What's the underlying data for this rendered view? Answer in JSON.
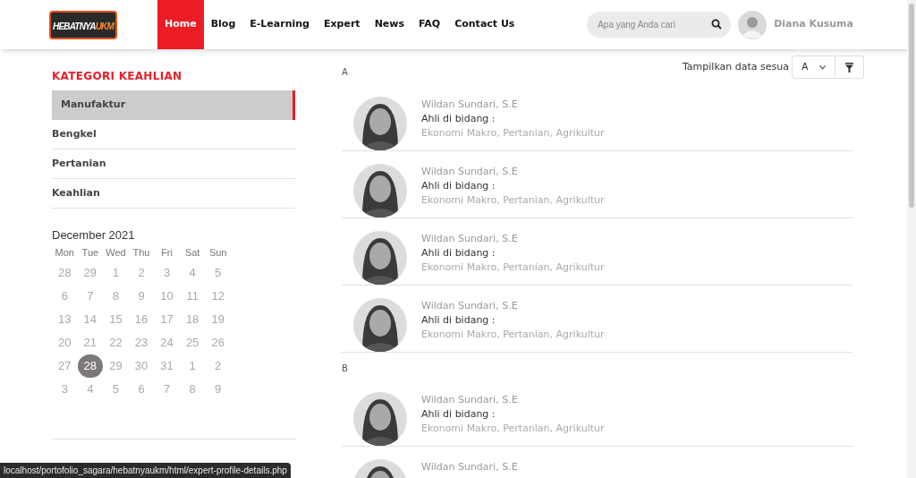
{
  "header": {
    "logo": {
      "word_1": "HEBATNYA",
      "word_2": "UKM"
    },
    "nav": [
      {
        "label": "Home",
        "selected": true
      },
      {
        "label": "Blog",
        "selected": false
      },
      {
        "label": "E-Learning",
        "selected": false
      },
      {
        "label": "Expert",
        "selected": false
      },
      {
        "label": "News",
        "selected": false
      },
      {
        "label": "FAQ",
        "selected": false
      },
      {
        "label": "Contact Us",
        "selected": false
      }
    ],
    "search": {
      "placeholder": "Apa yang Anda cari"
    },
    "user": {
      "name": "Diana Kusuma"
    }
  },
  "sidebar": {
    "title": "KATEGORI KEAHLIAN",
    "items": [
      {
        "label": "Manufaktur",
        "selected": true
      },
      {
        "label": "Bengkel",
        "selected": false
      },
      {
        "label": "Pertanian",
        "selected": false
      },
      {
        "label": "Keahlian",
        "selected": false
      }
    ],
    "calendar": {
      "title": "December 2021",
      "weekdays": [
        "Mon",
        "Tue",
        "Wed",
        "Thu",
        "Fri",
        "Sat",
        "Sun"
      ],
      "days": [
        {
          "label": "28",
          "selected": false
        },
        {
          "label": "29",
          "selected": false
        },
        {
          "label": "1",
          "selected": false
        },
        {
          "label": "2",
          "selected": false
        },
        {
          "label": "3",
          "selected": false
        },
        {
          "label": "4",
          "selected": false
        },
        {
          "label": "5",
          "selected": false
        },
        {
          "label": "6",
          "selected": false
        },
        {
          "label": "7",
          "selected": false
        },
        {
          "label": "8",
          "selected": false
        },
        {
          "label": "9",
          "selected": false
        },
        {
          "label": "10",
          "selected": false
        },
        {
          "label": "11",
          "selected": false
        },
        {
          "label": "12",
          "selected": false
        },
        {
          "label": "13",
          "selected": false
        },
        {
          "label": "14",
          "selected": false
        },
        {
          "label": "15",
          "selected": false
        },
        {
          "label": "16",
          "selected": false
        },
        {
          "label": "17",
          "selected": false
        },
        {
          "label": "18",
          "selected": false
        },
        {
          "label": "19",
          "selected": false
        },
        {
          "label": "20",
          "selected": false
        },
        {
          "label": "21",
          "selected": false
        },
        {
          "label": "22",
          "selected": false
        },
        {
          "label": "23",
          "selected": false
        },
        {
          "label": "24",
          "selected": false
        },
        {
          "label": "25",
          "selected": false
        },
        {
          "label": "26",
          "selected": false
        },
        {
          "label": "27",
          "selected": false
        },
        {
          "label": "28",
          "selected": true
        },
        {
          "label": "29",
          "selected": false
        },
        {
          "label": "30",
          "selected": false
        },
        {
          "label": "31",
          "selected": false
        },
        {
          "label": "1",
          "selected": false
        },
        {
          "label": "2",
          "selected": false
        },
        {
          "label": "3",
          "selected": false
        },
        {
          "label": "4",
          "selected": false
        },
        {
          "label": "5",
          "selected": false
        },
        {
          "label": "6",
          "selected": false
        },
        {
          "label": "7",
          "selected": false
        },
        {
          "label": "8",
          "selected": false
        },
        {
          "label": "9",
          "selected": false
        }
      ]
    }
  },
  "filter": {
    "label": "Tampilkan data sesua",
    "value": "A"
  },
  "groups": [
    {
      "letter": "A",
      "experts": [
        {
          "name": "Wildan Sundari, S.E",
          "field_label": "Ahli di bidang :",
          "fields": "Ekonomi Makro, Pertanian, Agrikultur"
        },
        {
          "name": "Wildan Sundari, S.E",
          "field_label": "Ahli di bidang :",
          "fields": "Ekonomi Makro, Pertanian, Agrikultur"
        },
        {
          "name": "Wildan Sundari, S.E",
          "field_label": "Ahli di bidang :",
          "fields": "Ekonomi Makro, Pertanian, Agrikultur"
        },
        {
          "name": "Wildan Sundari, S.E",
          "field_label": "Ahli di bidang :",
          "fields": "Ekonomi Makro, Pertanian, Agrikultur"
        }
      ]
    },
    {
      "letter": "B",
      "experts": [
        {
          "name": "Wildan Sundari, S.E",
          "field_label": "Ahli di bidang :",
          "fields": "Ekonomi Makro, Pertanian, Agrikultur"
        },
        {
          "name": "Wildan Sundari, S.E"
        }
      ]
    }
  ],
  "status_bar": {
    "url": "localhost/portofolio_sagara/hebatnyaukm/html/expert-profile-details.php"
  }
}
